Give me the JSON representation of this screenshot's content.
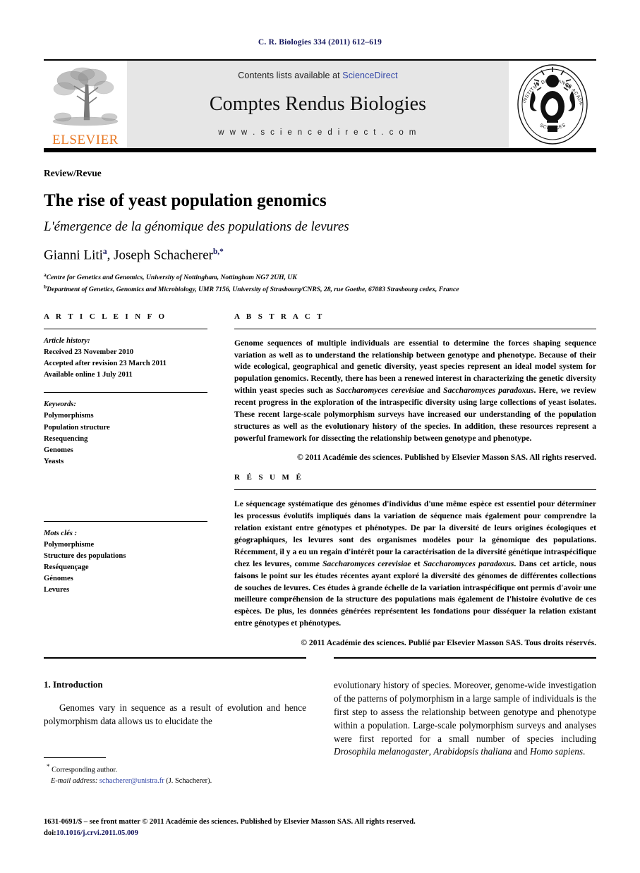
{
  "running_head": "C. R. Biologies 334 (2011) 612–619",
  "masthead": {
    "contents_prefix": "Contents lists available at ",
    "sciencedirect_label": "ScienceDirect",
    "journal_title": "Comptes Rendus Biologies",
    "url": "w w w . s c i e n c e d i r e c t . c o m",
    "publisher_wordmark": "ELSEVIER",
    "seal_top_text": "INSTITUT DE FRANCE",
    "seal_right_text": "ACADEMIE DES",
    "seal_bottom_text": "SCIENCES",
    "seal_year_left": "16",
    "seal_year_right": "66"
  },
  "title_block": {
    "article_type": "Review/Revue",
    "title": "The rise of yeast population genomics",
    "subtitle": "L'émergence de la génomique des populations de levures",
    "author_1": "Gianni Liti",
    "author_1_marker": "a",
    "author_separator": ", ",
    "author_2": "Joseph Schacherer",
    "author_2_marker": "b,*",
    "affiliation_a_marker": "a",
    "affiliation_a": "Centre for Genetics and Genomics, University of Nottingham, Nottingham NG7 2UH, UK",
    "affiliation_b_marker": "b",
    "affiliation_b": "Department of Genetics, Genomics and Microbiology, UMR 7156, University of Strasbourg/CNRS, 28, rue Goethe, 67083 Strasbourg cedex, France"
  },
  "article_info": {
    "heading": "A R T I C L E  I N F O",
    "history_title": "Article history:",
    "history": [
      "Received 23 November 2010",
      "Accepted after revision 23 March 2011",
      "Available online 1 July 2011"
    ],
    "keywords_title": "Keywords:",
    "keywords": [
      "Polymorphisms",
      "Population structure",
      "Resequencing",
      "Genomes",
      "Yeasts"
    ],
    "mots_cles_title": "Mots clés :",
    "mots_cles": [
      "Polymorphisme",
      "Structure des populations",
      "Reséquençage",
      "Génomes",
      "Levures"
    ]
  },
  "abstract": {
    "heading": "A B S T R A C T",
    "part1": "Genome sequences of multiple individuals are essential to determine the forces shaping sequence variation as well as to understand the relationship between genotype and phenotype. Because of their wide ecological, geographical and genetic diversity, yeast species represent an ideal model system for population genomics. Recently, there has been a renewed interest in characterizing the genetic diversity within yeast species such as ",
    "italic1": "Saccharomyces cerevisiae",
    "mid1": " and ",
    "italic2": "Saccharomyces paradoxus",
    "part2": ". Here, we review recent progress in the exploration of the intraspecific diversity using large collections of yeast isolates. These recent large-scale polymorphism surveys have increased our understanding of the population structures as well as the evolutionary history of the species. In addition, these resources represent a powerful framework for dissecting the relationship between genotype and phenotype.",
    "copyright": "© 2011 Académie des sciences. Published by Elsevier Masson SAS. All rights reserved."
  },
  "resume": {
    "heading": "R É S U M É",
    "part1": "Le séquencage systématique des génomes d'individus d'une même espèce est essentiel pour déterminer les processus évolutifs impliqués dans la variation de séquence mais également pour comprendre la relation existant entre génotypes et phénotypes. De par la diversité de leurs origines écologiques et géographiques, les levures sont des organismes modèles pour la génomique des populations. Récemment, il y a eu un regain d'intérêt pour la caractérisation de la diversité génétique intraspécifique chez les levures, comme ",
    "italic1": "Saccharomyces cerevisiae",
    "mid1": " et ",
    "italic2": "Saccharomyces paradoxus",
    "part2": ". Dans cet article, nous faisons le point sur les études récentes ayant exploré la diversité des génomes de différentes collections de souches de levures. Ces études à grande échelle de la variation intraspécifique ont permis d'avoir une meilleure compréhension de la structure des populations mais également de l'histoire évolutive de ces espèces. De plus, les données générées représentent les fondations pour disséquer la relation existant entre génotypes et phénotypes.",
    "copyright": "© 2011 Académie des sciences. Publié par Elsevier Masson SAS. Tous droits réservés."
  },
  "body": {
    "section_number_title": "1. Introduction",
    "left_paragraph": "Genomes vary in sequence as a result of evolution and hence polymorphism data allows us to elucidate the",
    "right_part1": "evolutionary history of species. Moreover, genome-wide investigation of the patterns of polymorphism in a large sample of individuals is the first step to assess the relationship between genotype and phenotype within a population. Large-scale polymorphism surveys and analyses were first reported for a small number of species including ",
    "right_italic1": "Drosophila melanogaster",
    "right_mid1": ", ",
    "right_italic2": "Arabidopsis thaliana",
    "right_mid2": " and ",
    "right_italic3": "Homo sapiens",
    "right_part2": "."
  },
  "footnote": {
    "star": "*",
    "corresponding": "Corresponding author.",
    "email_label": "E-mail address:",
    "email": "schacherer@unistra.fr",
    "email_suffix": "(J. Schacherer)."
  },
  "imprint": {
    "line1": "1631-0691/$ – see front matter © 2011 Académie des sciences. Published by Elsevier Masson SAS. All rights reserved.",
    "doi_prefix": "doi:",
    "doi": "10.1016/j.crvi.2011.05.009"
  },
  "colors": {
    "link_blue": "#2f43a6",
    "running_head_blue": "#15175e",
    "elsevier_orange": "#e87722",
    "panel_grey": "#e6e6e6"
  }
}
